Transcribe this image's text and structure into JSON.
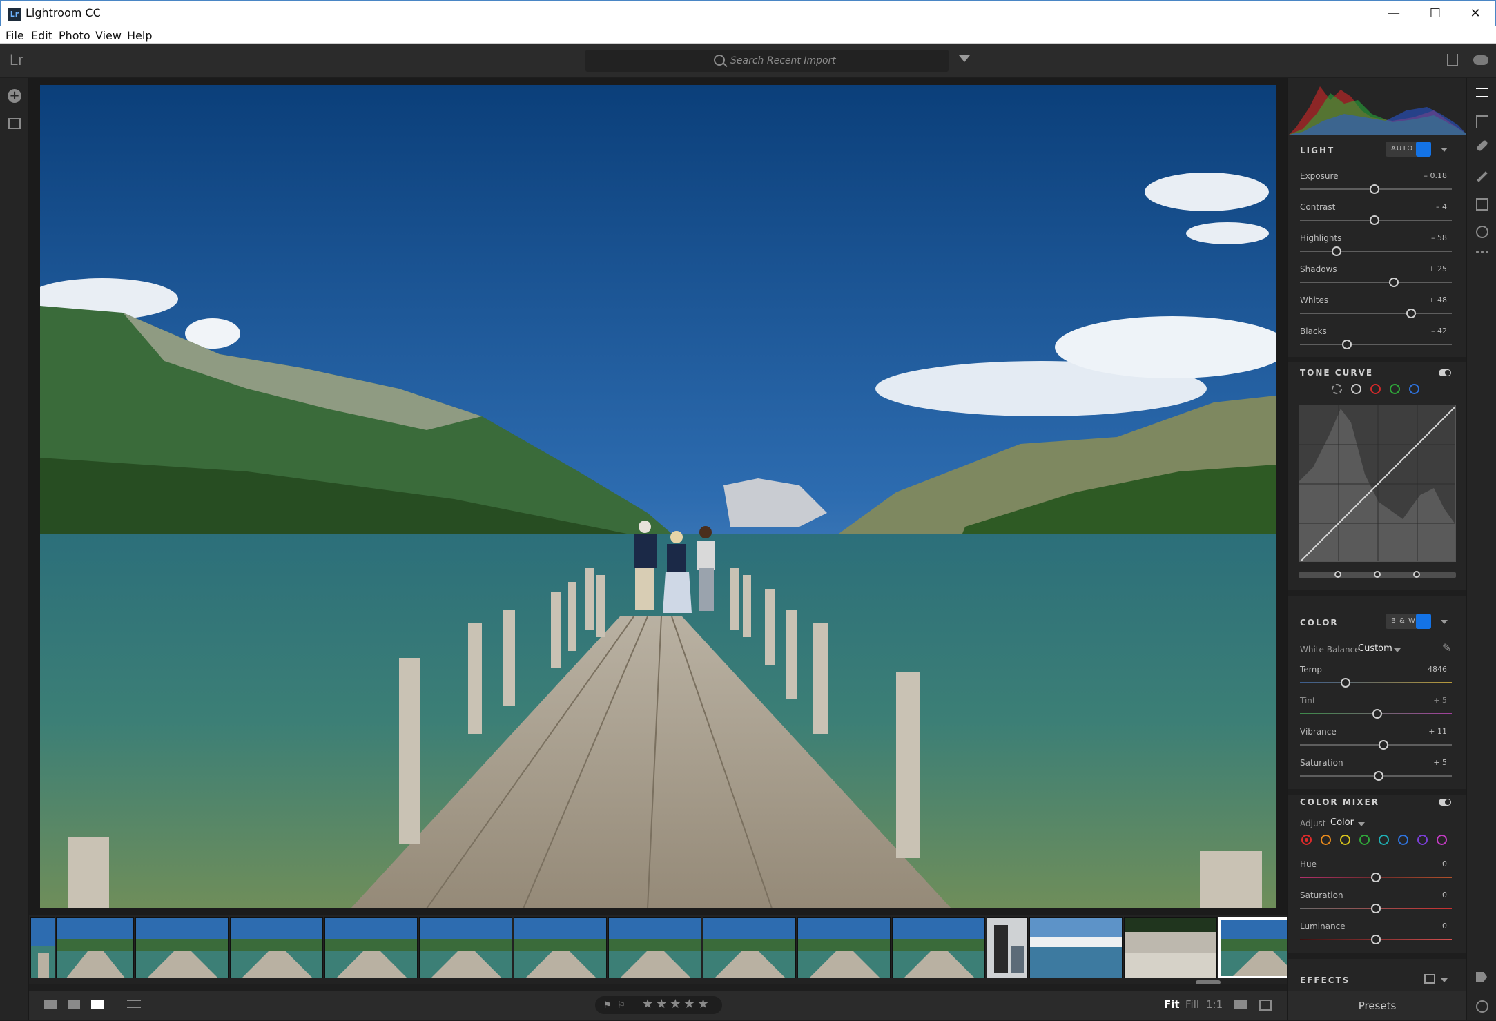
{
  "window": {
    "title": "Lightroom CC",
    "app_icon_text": "Lr",
    "minimize": "—",
    "maximize": "☐",
    "close": "✕"
  },
  "menu": [
    "File",
    "Edit",
    "Photo",
    "View",
    "Help"
  ],
  "toolbar": {
    "logo": "Lr",
    "search_placeholder": "Search Recent Import"
  },
  "filmstrip": {
    "selected_index": 12,
    "thumb_count": 13
  },
  "bottombar": {
    "stars": "★★★★★",
    "zoom": {
      "fit": "Fit",
      "fill": "Fill",
      "one_to_one": "1:1",
      "active": "Fit"
    }
  },
  "light": {
    "title": "LIGHT",
    "auto_label": "AUTO",
    "sliders": [
      {
        "label": "Exposure",
        "value": "– 0.18",
        "pos": 0.49
      },
      {
        "label": "Contrast",
        "value": "– 4",
        "pos": 0.49
      },
      {
        "label": "Highlights",
        "value": "– 58",
        "pos": 0.24
      },
      {
        "label": "Shadows",
        "value": "+ 25",
        "pos": 0.62
      },
      {
        "label": "Whites",
        "value": "+ 48",
        "pos": 0.73
      },
      {
        "label": "Blacks",
        "value": "– 42",
        "pos": 0.31
      }
    ]
  },
  "tone_curve": {
    "title": "TONE CURVE",
    "channels": [
      "parametric",
      "luminance",
      "red",
      "green",
      "blue"
    ]
  },
  "color": {
    "title": "COLOR",
    "bw_label": "B & W",
    "white_balance_label": "White Balance",
    "white_balance_value": "Custom",
    "sliders": [
      {
        "label": "Temp",
        "value": "4846",
        "pos": 0.3
      },
      {
        "label": "Tint",
        "value": "+ 5",
        "pos": 0.51
      },
      {
        "label": "Vibrance",
        "value": "+ 11",
        "pos": 0.55
      },
      {
        "label": "Saturation",
        "value": "+ 5",
        "pos": 0.52
      }
    ]
  },
  "color_mixer": {
    "title": "COLOR MIXER",
    "adjust_label": "Adjust",
    "adjust_value": "Color",
    "swatches": [
      "#e02b2b",
      "#e88a1c",
      "#d8c41c",
      "#2fa83a",
      "#1fb0b5",
      "#2f74e0",
      "#7b3fd8",
      "#c43bc4"
    ],
    "sliders": [
      {
        "label": "Hue",
        "value": "0",
        "pos": 0.5
      },
      {
        "label": "Saturation",
        "value": "0",
        "pos": 0.5
      },
      {
        "label": "Luminance",
        "value": "0",
        "pos": 0.5
      }
    ]
  },
  "effects": {
    "title": "EFFECTS"
  },
  "presets_label": "Presets"
}
